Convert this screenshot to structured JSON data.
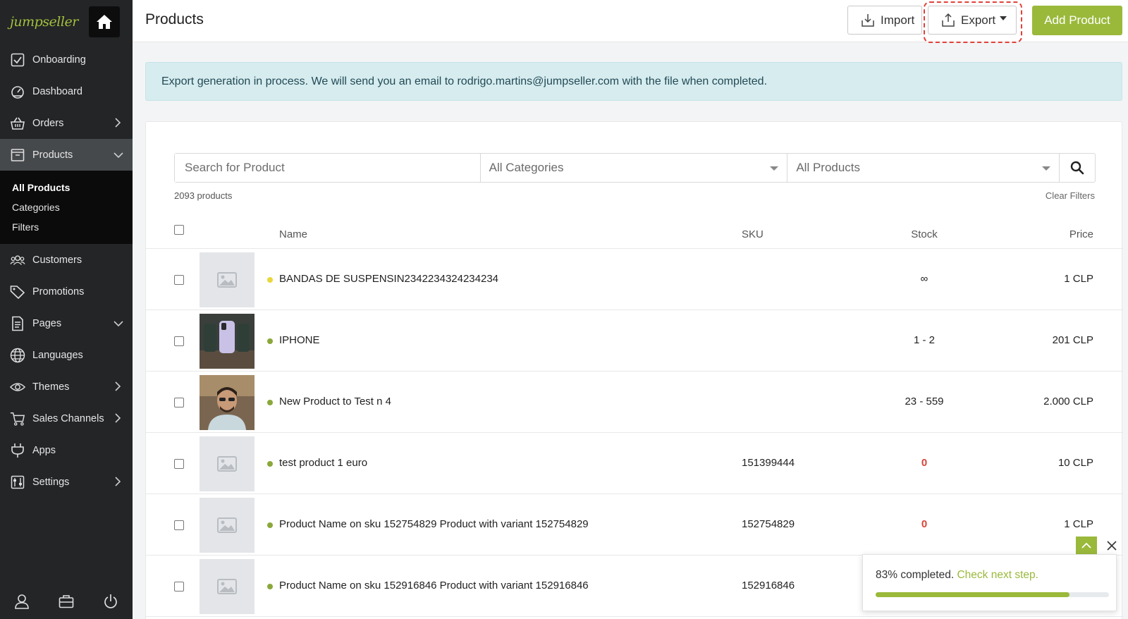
{
  "brand": {
    "logo_text": "jumpseller",
    "accent": "#9ab93b"
  },
  "sidebar": {
    "items": [
      {
        "label": "Onboarding",
        "icon": "checkbox-icon"
      },
      {
        "label": "Dashboard",
        "icon": "gauge-icon"
      },
      {
        "label": "Orders",
        "icon": "basket-icon"
      },
      {
        "label": "Products",
        "icon": "box-icon",
        "active": true
      },
      {
        "label": "Customers",
        "icon": "users-icon"
      },
      {
        "label": "Promotions",
        "icon": "tag-icon"
      },
      {
        "label": "Pages",
        "icon": "document-icon"
      },
      {
        "label": "Languages",
        "icon": "globe-icon"
      },
      {
        "label": "Themes",
        "icon": "eye-icon"
      },
      {
        "label": "Sales Channels",
        "icon": "cart-icon"
      },
      {
        "label": "Apps",
        "icon": "plug-icon"
      },
      {
        "label": "Settings",
        "icon": "sliders-icon"
      }
    ],
    "products_sub": [
      "All Products",
      "Categories",
      "Filters"
    ],
    "footer_icons": [
      "user-icon",
      "briefcase-icon",
      "power-icon"
    ]
  },
  "header": {
    "title": "Products",
    "import_label": "Import",
    "export_label": "Export",
    "add_label": "Add Product"
  },
  "alert": {
    "text": "Export generation in process. We will send you an email to rodrigo.martins@jumpseller.com with the file when completed."
  },
  "filters": {
    "search_placeholder": "Search for Product",
    "category": "All Categories",
    "product_filter": "All Products"
  },
  "summary": {
    "count": "2093 products",
    "clear": "Clear Filters"
  },
  "table": {
    "headers": {
      "name": "Name",
      "sku": "SKU",
      "stock": "Stock",
      "price": "Price"
    },
    "rows": [
      {
        "name": "BANDAS DE SUSPENSIN2342234324234234",
        "sku": "",
        "stock": "∞",
        "price": "1 CLP",
        "status": "yellow",
        "thumb": "placeholder"
      },
      {
        "name": "IPHONE",
        "sku": "",
        "stock": "1 - 2",
        "price": "201 CLP",
        "status": "green",
        "thumb": "phones"
      },
      {
        "name": "New Product to Test n 4",
        "sku": "",
        "stock": "23 - 559",
        "price": "2.000 CLP",
        "status": "green",
        "thumb": "person"
      },
      {
        "name": "test product 1 euro",
        "sku": "151399444",
        "stock": "0",
        "price": "10 CLP",
        "status": "green",
        "thumb": "placeholder"
      },
      {
        "name": "Product Name on sku 152754829 Product with variant 152754829",
        "sku": "152754829",
        "stock": "0",
        "price": "1 CLP",
        "status": "green",
        "thumb": "placeholder"
      },
      {
        "name": "Product Name on sku 152916846 Product with variant 152916846",
        "sku": "152916846",
        "stock": "",
        "price": "",
        "status": "green",
        "thumb": "placeholder"
      }
    ]
  },
  "progress": {
    "text": "83% completed.",
    "link": "Check next step.",
    "percent": 83
  }
}
